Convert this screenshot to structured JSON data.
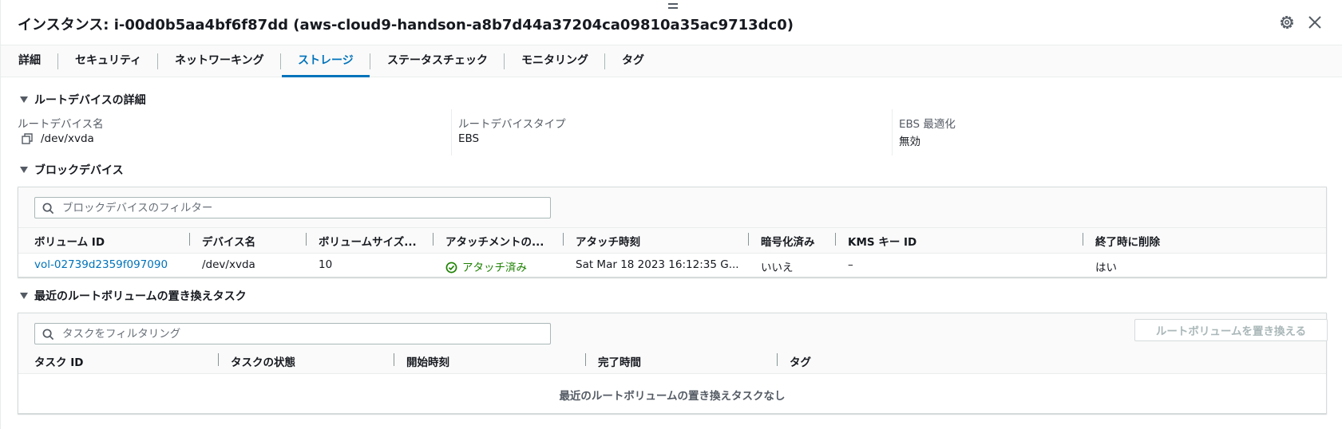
{
  "header": {
    "title": "インスタンス: i-00d0b5aa4bf6f87dd (aws-cloud9-handson-a8b7d44a37204ca09810a35ac9713dc0)",
    "settings_icon": "gear-icon",
    "close_icon": "close-icon"
  },
  "tabs": [
    {
      "label": "詳細",
      "active": false
    },
    {
      "label": "セキュリティ",
      "active": false
    },
    {
      "label": "ネットワーキング",
      "active": false
    },
    {
      "label": "ストレージ",
      "active": true
    },
    {
      "label": "ステータスチェック",
      "active": false
    },
    {
      "label": "モニタリング",
      "active": false
    },
    {
      "label": "タグ",
      "active": false
    }
  ],
  "root_device": {
    "section_title": "ルートデバイスの詳細",
    "fields": [
      {
        "label": "ルートデバイス名",
        "value": "/dev/xvda"
      },
      {
        "label": "ルートデバイスタイプ",
        "value": "EBS"
      },
      {
        "label": "EBS 最適化",
        "value": "無効"
      }
    ]
  },
  "block_devices": {
    "section_title": "ブロックデバイス",
    "filter_placeholder": "ブロックデバイスのフィルター",
    "columns": [
      "ボリューム ID",
      "デバイス名",
      "ボリュームサイズ...",
      "アタッチメントの...",
      "アタッチ時刻",
      "暗号化済み",
      "KMS キー ID",
      "終了時に削除"
    ],
    "rows": [
      {
        "volume_id": "vol-02739d2359f097090",
        "device_name": "/dev/xvda",
        "volume_size": "10",
        "attachment_status": "アタッチ済み",
        "attach_time": "Sat Mar 18 2023 16:12:35 G...",
        "encrypted": "いいえ",
        "kms_key_id": "–",
        "delete_on_termination": "はい"
      }
    ]
  },
  "replace_tasks": {
    "section_title": "最近のルートボリュームの置き換えタスク",
    "filter_placeholder": "タスクをフィルタリング",
    "replace_button": "ルートボリュームを置き換える",
    "columns": [
      "タスク ID",
      "タスクの状態",
      "開始時刻",
      "完了時間",
      "タグ"
    ],
    "empty_message": "最近のルートボリュームの置き換えタスクなし"
  },
  "colors": {
    "accent": "#0073bb",
    "success": "#1d8102",
    "text": "#16191f",
    "muted": "#545b64"
  }
}
